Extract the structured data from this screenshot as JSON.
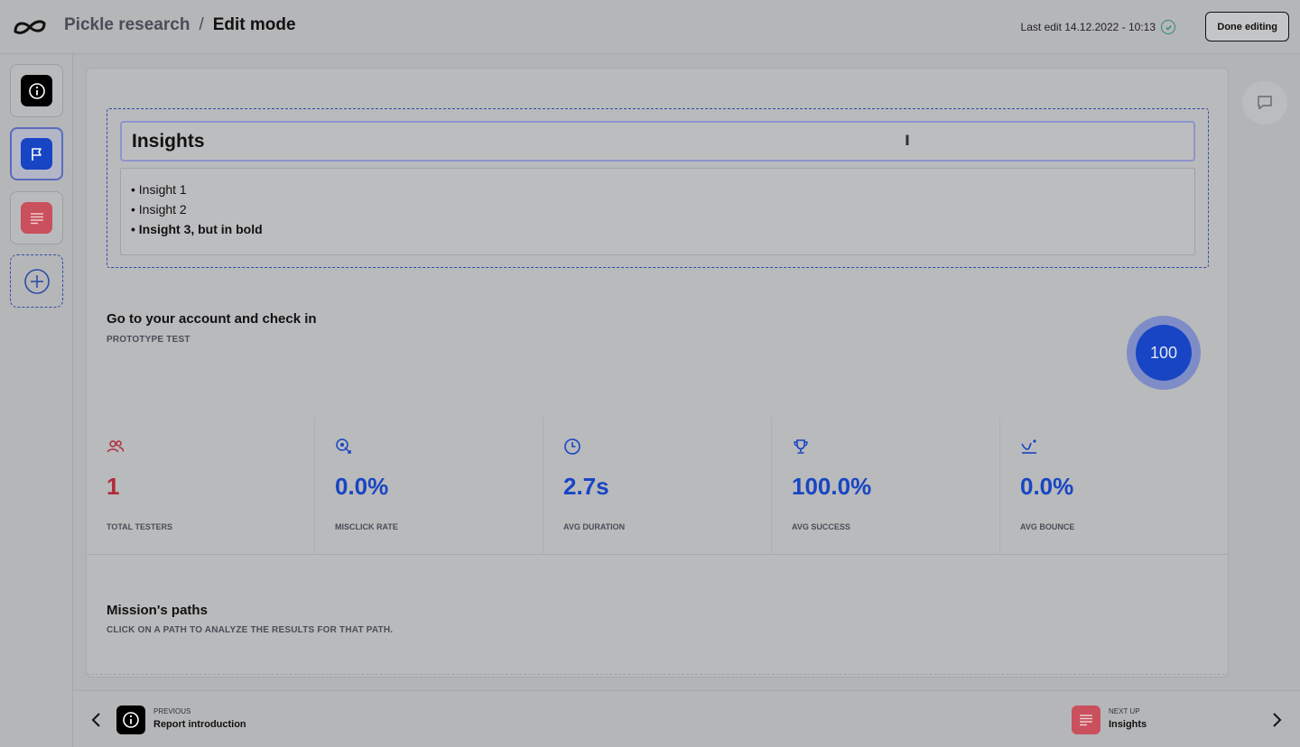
{
  "header": {
    "project": "Pickle research",
    "separator": "/",
    "mode": "Edit mode",
    "last_edit": "Last edit 14.12.2022 - 10:13",
    "done_label": "Done editing"
  },
  "sidebar": {
    "items": [
      {
        "icon": "info-icon",
        "color": "#000000"
      },
      {
        "icon": "flag-icon",
        "color": "#1745c4"
      },
      {
        "icon": "text-lines-icon",
        "color": "#c9505c"
      },
      {
        "icon": "plus-circle-icon",
        "color": "#2c4ea8"
      }
    ]
  },
  "editor": {
    "title": "Insights",
    "bullets": [
      "• Insight 1",
      "• Insight 2",
      "• Insight 3, but in bold"
    ]
  },
  "task": {
    "title": "Go to your account and check in",
    "subtitle": "PROTOTYPE TEST",
    "score": "100"
  },
  "stats": [
    {
      "icon": "users-icon",
      "value": "1",
      "label": "TOTAL TESTERS",
      "color": "#b02a3c"
    },
    {
      "icon": "misclick-icon",
      "value": "0.0%",
      "label": "MISCLICK RATE",
      "color": "#1745c4"
    },
    {
      "icon": "clock-icon",
      "value": "2.7s",
      "label": "AVG DURATION",
      "color": "#1745c4"
    },
    {
      "icon": "trophy-icon",
      "value": "100.0%",
      "label": "AVG SUCCESS",
      "color": "#1745c4"
    },
    {
      "icon": "bounce-icon",
      "value": "0.0%",
      "label": "AVG BOUNCE",
      "color": "#1745c4"
    }
  ],
  "paths": {
    "title": "Mission's paths",
    "subtitle": "CLICK ON A PATH TO ANALYZE THE RESULTS FOR THAT PATH."
  },
  "footer": {
    "previous_small": "PREVIOUS",
    "previous_label": "Report introduction",
    "next_small": "NEXT UP",
    "next_label": "Insights"
  },
  "colors": {
    "accent": "#1745c4",
    "danger": "#b02a3c"
  }
}
